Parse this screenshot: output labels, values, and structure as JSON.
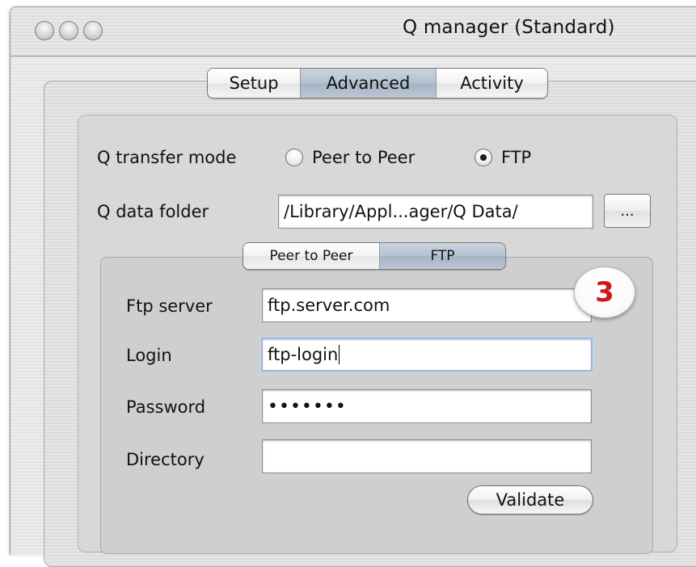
{
  "window": {
    "title": "Q manager (Standard)"
  },
  "main_tabs": [
    {
      "label": "Setup",
      "selected": false
    },
    {
      "label": "Advanced",
      "selected": true
    },
    {
      "label": "Activity",
      "selected": false
    }
  ],
  "transfer_mode": {
    "label": "Q transfer mode",
    "options": [
      {
        "label": "Peer to Peer",
        "checked": false
      },
      {
        "label": "FTP",
        "checked": true
      }
    ]
  },
  "data_folder": {
    "label": "Q data folder",
    "value": "/Library/Appl...ager/Q Data/",
    "browse_label": "..."
  },
  "sub_tabs": [
    {
      "label": "Peer to Peer",
      "selected": false
    },
    {
      "label": "FTP",
      "selected": true
    }
  ],
  "ftp": {
    "server_label": "Ftp server",
    "server_value": "ftp.server.com",
    "login_label": "Login",
    "login_value": "ftp-login",
    "password_label": "Password",
    "password_value": "•••••••",
    "directory_label": "Directory",
    "directory_value": "",
    "validate_label": "Validate"
  },
  "step_badge": {
    "number": "3",
    "color": "#d1151b"
  }
}
